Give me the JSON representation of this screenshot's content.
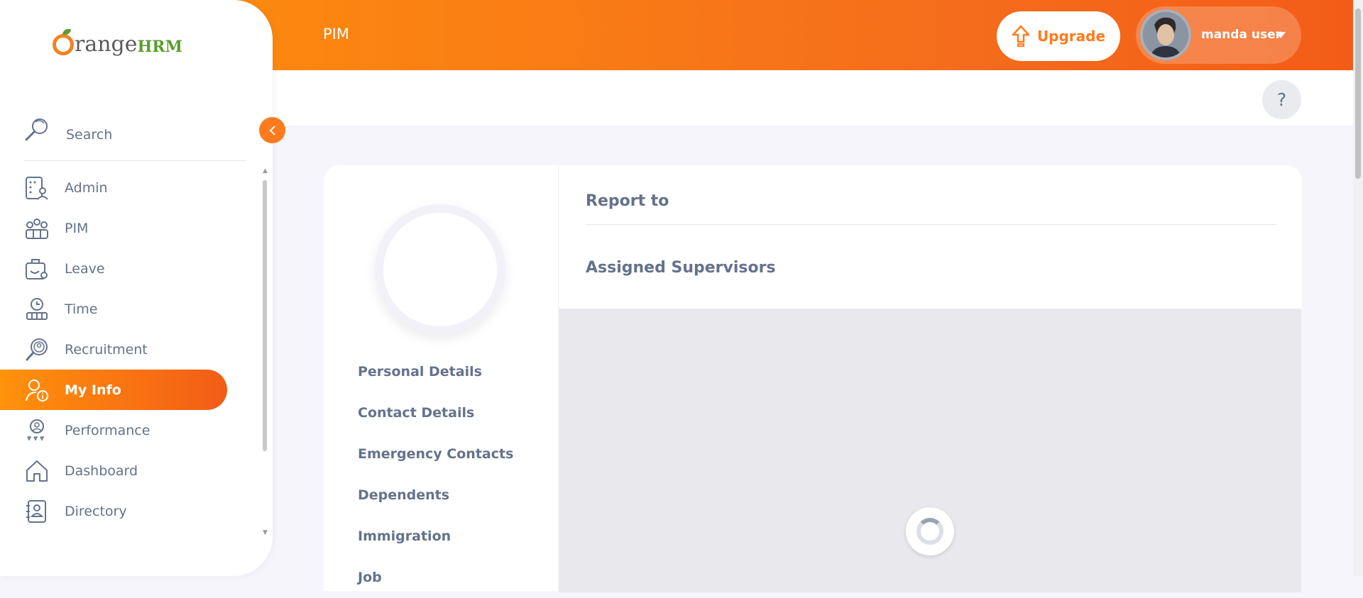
{
  "header": {
    "module_title": "PIM",
    "upgrade_label": "Upgrade",
    "user_name": "manda user"
  },
  "help": {
    "label": "?"
  },
  "sidebar": {
    "logo": {
      "part1": "range",
      "part2": "HRM"
    },
    "search_placeholder": "Search",
    "items": [
      {
        "label": "Admin",
        "icon": "admin-icon"
      },
      {
        "label": "PIM",
        "icon": "pim-icon"
      },
      {
        "label": "Leave",
        "icon": "leave-icon"
      },
      {
        "label": "Time",
        "icon": "time-icon"
      },
      {
        "label": "Recruitment",
        "icon": "recruitment-icon"
      },
      {
        "label": "My Info",
        "icon": "my-info-icon",
        "active": true
      },
      {
        "label": "Performance",
        "icon": "performance-icon"
      },
      {
        "label": "Dashboard",
        "icon": "dashboard-icon"
      },
      {
        "label": "Directory",
        "icon": "directory-icon"
      }
    ]
  },
  "profile": {
    "tabs": [
      "Personal Details",
      "Contact Details",
      "Emergency Contacts",
      "Dependents",
      "Immigration",
      "Job"
    ]
  },
  "report_to": {
    "title": "Report to",
    "supervisors_title": "Assigned Supervisors"
  },
  "colors": {
    "accent": "#ff7b1d",
    "text": "#64728c"
  }
}
